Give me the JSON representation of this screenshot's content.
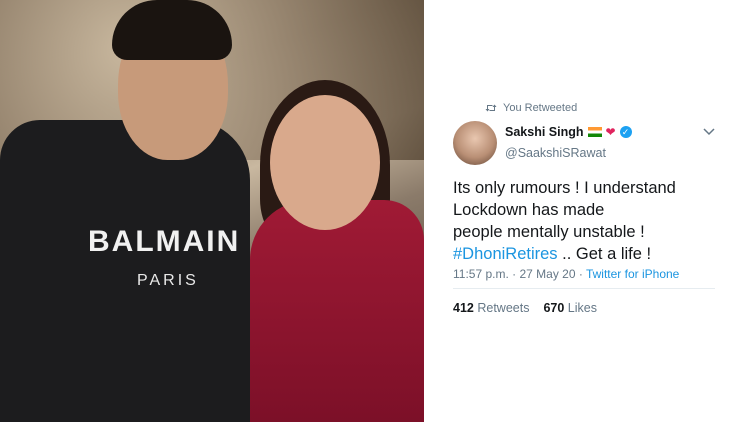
{
  "photo": {
    "shirt_brand": "BALMAIN",
    "shirt_city": "PARIS"
  },
  "tweet": {
    "retweet_label": "You Retweeted",
    "author_name": "Sakshi Singh",
    "author_emojis": "🇮🇳❤",
    "author_handle": "@SaakshiSRawat",
    "text_lines": [
      "Its only rumours ! I understand",
      "Lockdown has made",
      "people mentally unstable !"
    ],
    "hashtag": "#DhoniRetires",
    "text_tail": " .. Get a life !",
    "time": "11:57 p.m. · 27 May 20 · ",
    "source": "Twitter for iPhone",
    "retweets_count": "412",
    "retweets_label": "Retweets",
    "likes_count": "670",
    "likes_label": "Likes"
  },
  "colors": {
    "link": "#1b95e0",
    "muted": "#657786",
    "text": "#14171a",
    "verified": "#1da1f2",
    "heart": "#e0245e"
  },
  "icons": [
    "retweet-icon",
    "india-flag-icon",
    "heart-icon",
    "verified-badge-icon",
    "chevron-down-icon"
  ]
}
